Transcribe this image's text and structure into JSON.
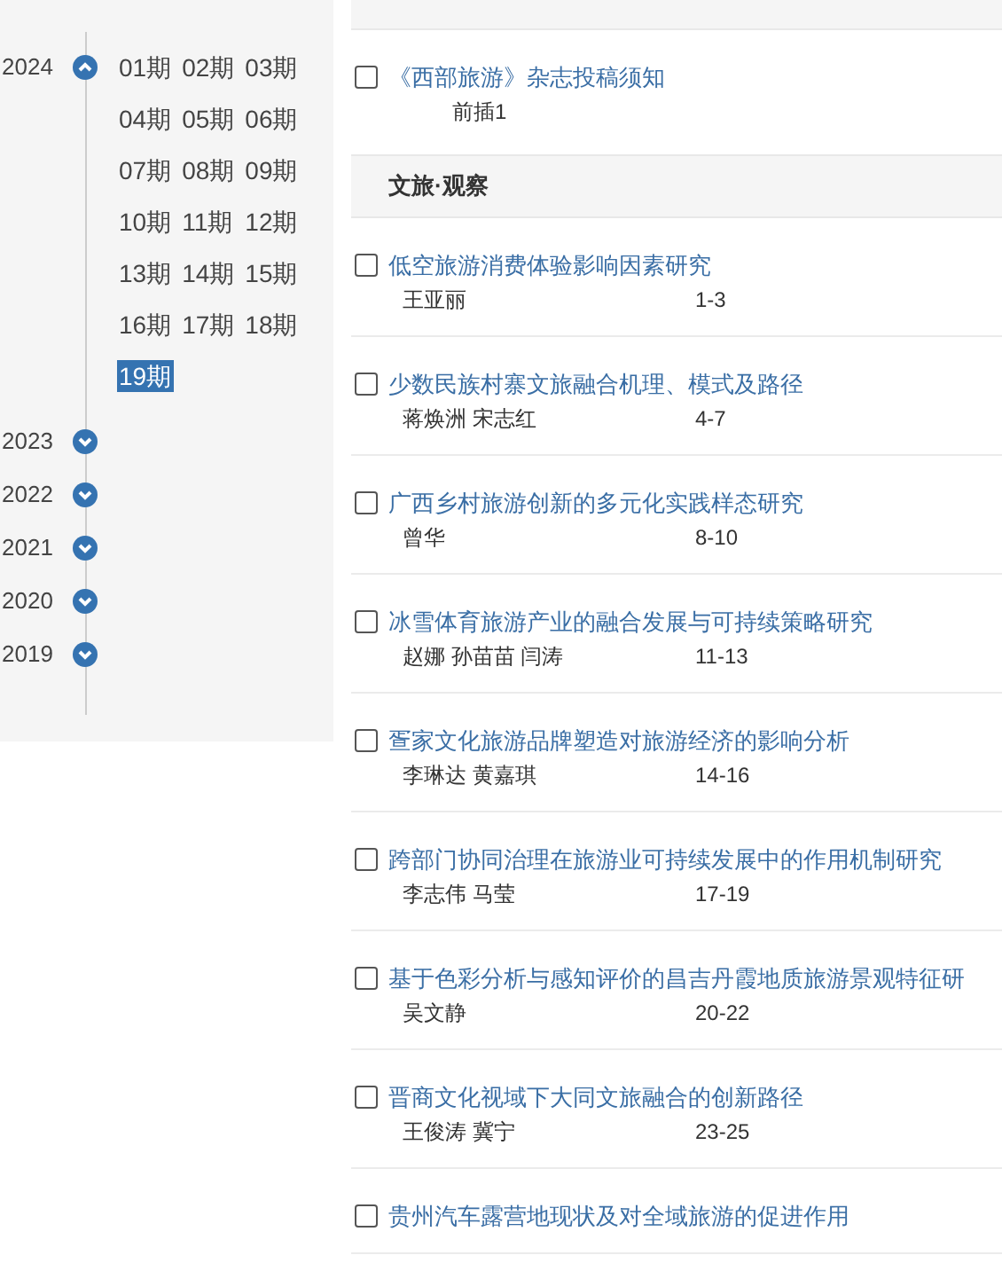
{
  "sidebar": {
    "years": [
      {
        "year": "2024",
        "expanded": true,
        "issues": [
          {
            "label": "01期",
            "selected": false
          },
          {
            "label": "02期",
            "selected": false
          },
          {
            "label": "03期",
            "selected": false
          },
          {
            "label": "04期",
            "selected": false
          },
          {
            "label": "05期",
            "selected": false
          },
          {
            "label": "06期",
            "selected": false
          },
          {
            "label": "07期",
            "selected": false
          },
          {
            "label": "08期",
            "selected": false
          },
          {
            "label": "09期",
            "selected": false
          },
          {
            "label": "10期",
            "selected": false
          },
          {
            "label": "11期",
            "selected": false
          },
          {
            "label": "12期",
            "selected": false
          },
          {
            "label": "13期",
            "selected": false
          },
          {
            "label": "14期",
            "selected": false
          },
          {
            "label": "15期",
            "selected": false
          },
          {
            "label": "16期",
            "selected": false
          },
          {
            "label": "17期",
            "selected": false
          },
          {
            "label": "18期",
            "selected": false
          },
          {
            "label": "19期",
            "selected": true
          }
        ]
      },
      {
        "year": "2023",
        "expanded": false
      },
      {
        "year": "2022",
        "expanded": false
      },
      {
        "year": "2021",
        "expanded": false
      },
      {
        "year": "2020",
        "expanded": false
      },
      {
        "year": "2019",
        "expanded": false
      }
    ]
  },
  "contents": [
    {
      "kind": "article",
      "title": "《西部旅游》杂志投稿须知",
      "pages": "前插1",
      "checked": false
    },
    {
      "kind": "section",
      "title": "文旅·观察"
    },
    {
      "kind": "article",
      "title": "低空旅游消费体验影响因素研究",
      "authors": "王亚丽",
      "pages": "1-3",
      "checked": false
    },
    {
      "kind": "article",
      "title": "少数民族村寨文旅融合机理、模式及路径",
      "authors": "蒋焕洲 宋志红",
      "pages": "4-7",
      "checked": false
    },
    {
      "kind": "article",
      "title": "广西乡村旅游创新的多元化实践样态研究",
      "authors": "曾华",
      "pages": "8-10",
      "checked": false
    },
    {
      "kind": "article",
      "title": "冰雪体育旅游产业的融合发展与可持续策略研究",
      "authors": "赵娜 孙苗苗 闫涛",
      "pages": "11-13",
      "checked": false
    },
    {
      "kind": "article",
      "title": "疍家文化旅游品牌塑造对旅游经济的影响分析",
      "authors": "李琳达 黄嘉琪",
      "pages": "14-16",
      "checked": false
    },
    {
      "kind": "article",
      "title": "跨部门协同治理在旅游业可持续发展中的作用机制研究",
      "authors": "李志伟 马莹",
      "pages": "17-19",
      "checked": false
    },
    {
      "kind": "article",
      "title": "基于色彩分析与感知评价的昌吉丹霞地质旅游景观特征研",
      "authors": "吴文静",
      "pages": "20-22",
      "checked": false
    },
    {
      "kind": "article",
      "title": "晋商文化视域下大同文旅融合的创新路径",
      "authors": "王俊涛 冀宁",
      "pages": "23-25",
      "checked": false
    },
    {
      "kind": "article",
      "title": "贵州汽车露营地现状及对全域旅游的促进作用",
      "checked": false
    }
  ]
}
